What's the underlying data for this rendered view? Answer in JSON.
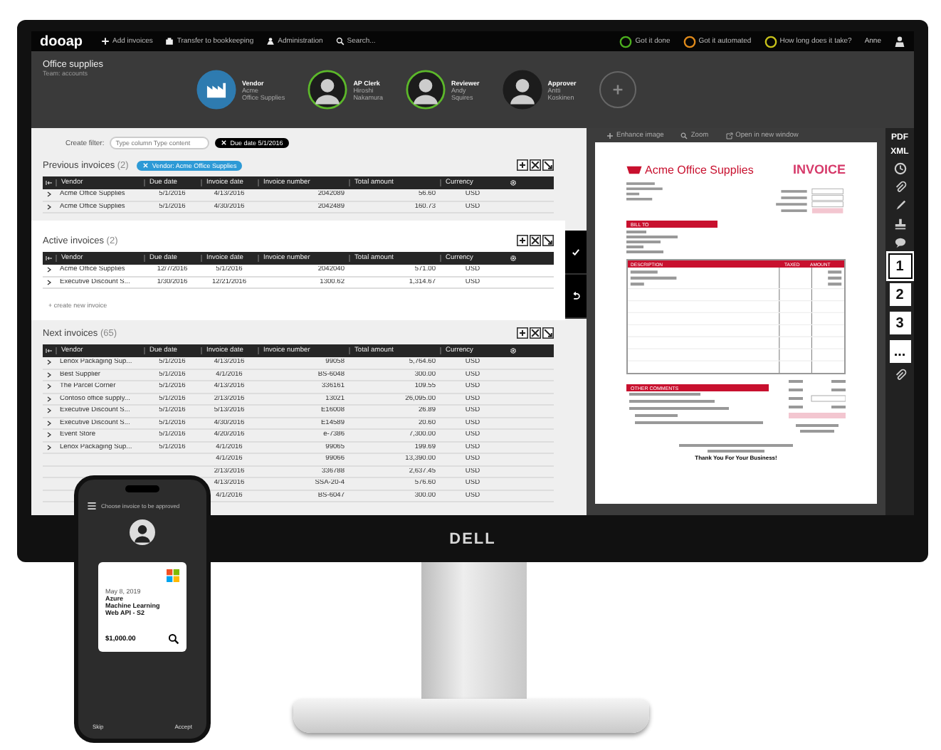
{
  "app": {
    "logo": "dooap",
    "menu": [
      {
        "label": "Add invoices"
      },
      {
        "label": "Transfer to bookkeeping"
      },
      {
        "label": "Administration"
      },
      {
        "label": "Search..."
      }
    ],
    "goals": [
      {
        "label": "Got it done",
        "color": "#4caf1e"
      },
      {
        "label": "Got it automated",
        "color": "#e08a1a"
      },
      {
        "label": "How long does it take?",
        "color": "#c8c21a"
      }
    ],
    "user": "Anne"
  },
  "workflow": {
    "title": "Office supplies",
    "subtitle": "Team: accounts",
    "steps": [
      {
        "kind": "vendor",
        "role": "Vendor",
        "name": "Acme",
        "detail": "Office Supplies",
        "done": false
      },
      {
        "kind": "person",
        "role": "AP Clerk",
        "name": "Hiroshi",
        "detail": "Nakamura",
        "done": true
      },
      {
        "kind": "person",
        "role": "Reviewer",
        "name": "Andy",
        "detail": "Squires",
        "done": true
      },
      {
        "kind": "person",
        "role": "Approver",
        "name": "Antti",
        "detail": "Koskinen",
        "done": false
      }
    ]
  },
  "filter": {
    "label": "Create filter:",
    "placeholder": "Type column Type content",
    "chip": "Due date 5/1/2016"
  },
  "sections": [
    {
      "title": "Previous invoices",
      "count": "(2)",
      "chip": "Vendor: Acme Office Supplies",
      "columns": [
        "Vendor",
        "Due date",
        "Invoice date",
        "Invoice number",
        "Total amount",
        "Currency"
      ],
      "rows": [
        {
          "vendor": "Acme Office Supplies",
          "due": "5/1/2016",
          "issued": "4/13/2016",
          "number": "2042089",
          "total": "56.60",
          "currency": "USD"
        },
        {
          "vendor": "Acme Office Supplies",
          "due": "5/1/2016",
          "issued": "4/30/2016",
          "number": "2042489",
          "total": "160.73",
          "currency": "USD"
        }
      ]
    },
    {
      "title": "Active invoices",
      "count": "(2)",
      "create": "+ create new invoice",
      "columns": [
        "Vendor",
        "Due date",
        "Invoice date",
        "Invoice number",
        "Total amount",
        "Currency"
      ],
      "rows": [
        {
          "vendor": "Acme Office Supplies",
          "due": "12/7/2016",
          "issued": "5/1/2016",
          "number": "2042040",
          "total": "571.00",
          "currency": "USD"
        },
        {
          "vendor": "Executive Discount S...",
          "due": "1/30/2016",
          "issued": "12/21/2016",
          "number": "1300.62",
          "total": "1,314.67",
          "currency": "USD"
        }
      ]
    },
    {
      "title": "Next invoices",
      "count": "(65)",
      "columns": [
        "Vendor",
        "Due date",
        "Invoice date",
        "Invoice number",
        "Total amount",
        "Currency"
      ],
      "rows": [
        {
          "vendor": "Lenox Packaging Sup...",
          "due": "5/1/2016",
          "issued": "4/13/2016",
          "number": "99058",
          "total": "5,764.60",
          "currency": "USD"
        },
        {
          "vendor": "Best Supplier",
          "due": "5/1/2016",
          "issued": "4/1/2016",
          "number": "BS-6048",
          "total": "300.00",
          "currency": "USD"
        },
        {
          "vendor": "The Parcel Corner",
          "due": "5/1/2016",
          "issued": "4/13/2016",
          "number": "336161",
          "total": "109.55",
          "currency": "USD"
        },
        {
          "vendor": "Contoso office supply...",
          "due": "5/1/2016",
          "issued": "2/13/2016",
          "number": "13021",
          "total": "26,095.00",
          "currency": "USD"
        },
        {
          "vendor": "Executive Discount S...",
          "due": "5/1/2016",
          "issued": "5/13/2016",
          "number": "E16008",
          "total": "26.89",
          "currency": "USD"
        },
        {
          "vendor": "Executive Discount S...",
          "due": "5/1/2016",
          "issued": "4/30/2016",
          "number": "E14589",
          "total": "20.60",
          "currency": "USD"
        },
        {
          "vendor": "Event Store",
          "due": "5/1/2016",
          "issued": "4/20/2016",
          "number": "e-7386",
          "total": "7,300.00",
          "currency": "USD"
        },
        {
          "vendor": "Lenox Packaging Sup...",
          "due": "5/1/2016",
          "issued": "4/1/2016",
          "number": "99065",
          "total": "199.69",
          "currency": "USD"
        },
        {
          "issued": "4/1/2016",
          "number": "99066",
          "total": "13,390.00",
          "currency": "USD"
        },
        {
          "issued": "2/13/2016",
          "number": "336788",
          "total": "2,637.45",
          "currency": "USD"
        },
        {
          "issued": "4/13/2016",
          "number": "SSA-20-4",
          "total": "576.60",
          "currency": "USD"
        },
        {
          "issued": "4/1/2016",
          "number": "BS-6047",
          "total": "300.00",
          "currency": "USD"
        }
      ]
    }
  ],
  "viewer": {
    "tools": [
      {
        "label": "Enhance image"
      },
      {
        "label": "Zoom"
      },
      {
        "label": "Open in new window"
      }
    ],
    "invoice": {
      "company": "Acme Office Supplies",
      "title": "INVOICE",
      "bill_to": "BILL TO",
      "columns": [
        "DESCRIPTION",
        "TAXED",
        "AMOUNT"
      ],
      "comments": "OTHER COMMENTS",
      "thanks": "Thank You For Your Business!"
    }
  },
  "sidebar": [
    {
      "kind": "text",
      "label": "PDF"
    },
    {
      "kind": "text",
      "label": "XML"
    },
    {
      "kind": "icon"
    },
    {
      "kind": "icon"
    },
    {
      "kind": "icon"
    },
    {
      "kind": "icon"
    },
    {
      "kind": "icon"
    },
    {
      "kind": "page",
      "label": "1",
      "selected": true
    },
    {
      "kind": "page",
      "label": "2",
      "selected": false
    },
    {
      "kind": "page",
      "label": "3",
      "selected": false
    },
    {
      "kind": "page",
      "label": "...",
      "selected": false
    },
    {
      "kind": "icon"
    }
  ],
  "monitor": {
    "brand": "DELL"
  },
  "phone": {
    "prompt": "Choose invoice to be approved",
    "card": {
      "date": "May 8, 2019",
      "lines": [
        "Azure",
        "Machine Learning",
        "Web API - S2"
      ],
      "amount": "$1,000.00"
    },
    "actions": [
      "Skip",
      "Accept"
    ]
  }
}
